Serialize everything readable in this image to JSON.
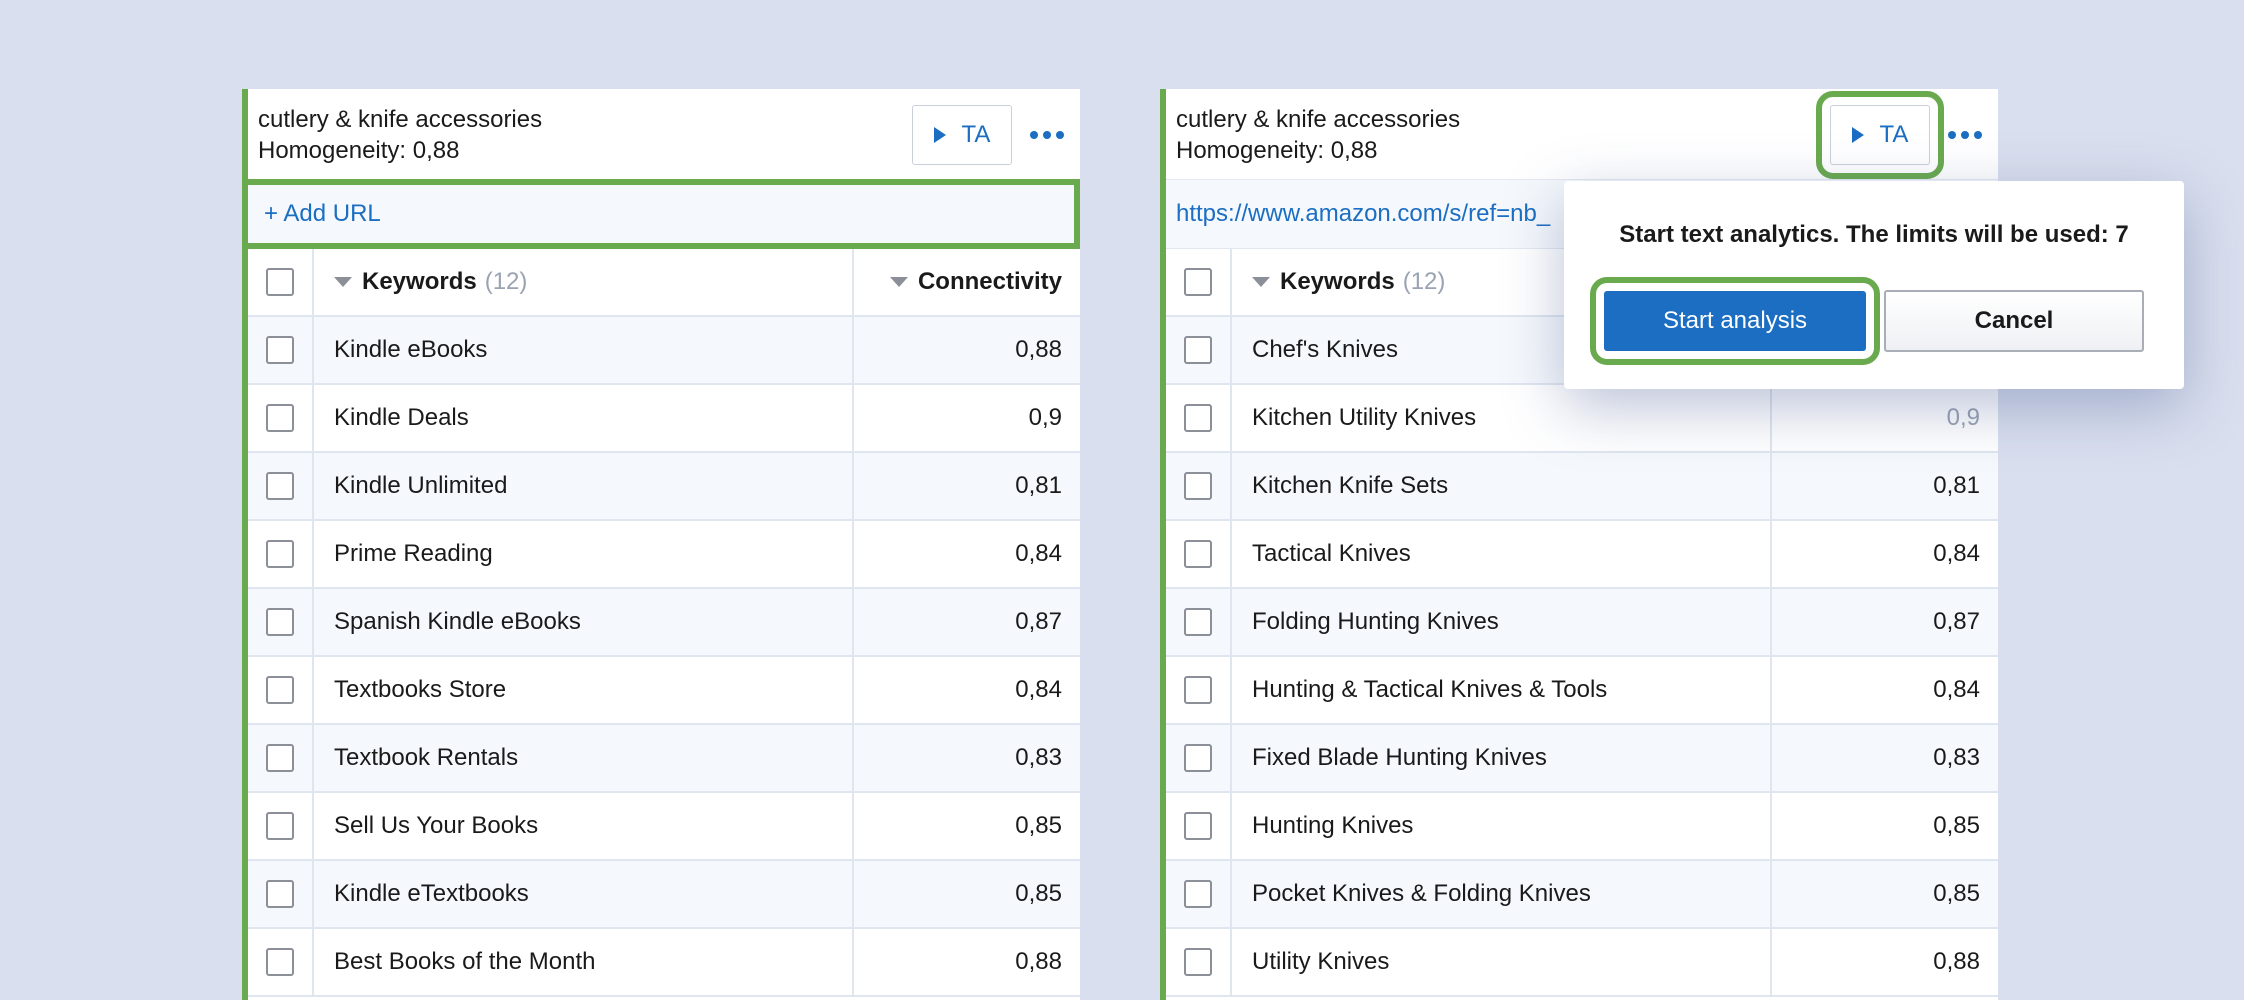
{
  "left_panel": {
    "title": "cutlery & knife accessories",
    "homogeneity": "Homogeneity: 0,88",
    "ta_label": "TA",
    "url_text": "+ Add URL",
    "keywords_header": "Keywords",
    "keywords_count": "(12)",
    "connectivity_header": "Connectivity",
    "rows": [
      {
        "keyword": "Kindle eBooks",
        "value": "0,88"
      },
      {
        "keyword": "Kindle Deals",
        "value": "0,9"
      },
      {
        "keyword": "Kindle Unlimited",
        "value": "0,81"
      },
      {
        "keyword": "Prime Reading",
        "value": "0,84"
      },
      {
        "keyword": "Spanish Kindle eBooks",
        "value": "0,87"
      },
      {
        "keyword": "Textbooks Store",
        "value": "0,84"
      },
      {
        "keyword": "Textbook Rentals",
        "value": "0,83"
      },
      {
        "keyword": "Sell Us Your Books",
        "value": "0,85"
      },
      {
        "keyword": "Kindle eTextbooks",
        "value": "0,85"
      },
      {
        "keyword": "Best Books of the Month",
        "value": "0,88"
      }
    ]
  },
  "right_panel": {
    "title": "cutlery & knife accessories",
    "homogeneity": "Homogeneity: 0,88",
    "ta_label": "TA",
    "url_text": "https://www.amazon.com/s/ref=nb_",
    "keywords_header": "Keywords",
    "keywords_count": "(12)",
    "rows": [
      {
        "keyword": "Chef's Knives",
        "value": ""
      },
      {
        "keyword": "Kitchen Utility Knives",
        "value": "0,9"
      },
      {
        "keyword": "Kitchen Knife Sets",
        "value": "0,81"
      },
      {
        "keyword": "Tactical Knives",
        "value": "0,84"
      },
      {
        "keyword": "Folding Hunting Knives",
        "value": "0,87"
      },
      {
        "keyword": "Hunting & Tactical Knives & Tools",
        "value": "0,84"
      },
      {
        "keyword": "Fixed Blade Hunting Knives",
        "value": "0,83"
      },
      {
        "keyword": "Hunting Knives",
        "value": "0,85"
      },
      {
        "keyword": "Pocket Knives & Folding Knives",
        "value": "0,85"
      },
      {
        "keyword": "Utility Knives",
        "value": "0,88"
      }
    ]
  },
  "popover": {
    "message": "Start text analytics. The limits will be used: 7",
    "start_label": "Start analysis",
    "cancel_label": "Cancel"
  },
  "colors": {
    "accent": "#1b6ec2",
    "highlight": "#6aaa4f",
    "background": "#d9dfee"
  },
  "icons": [
    "play-icon",
    "more-icon",
    "sort-icon",
    "checkbox"
  ]
}
